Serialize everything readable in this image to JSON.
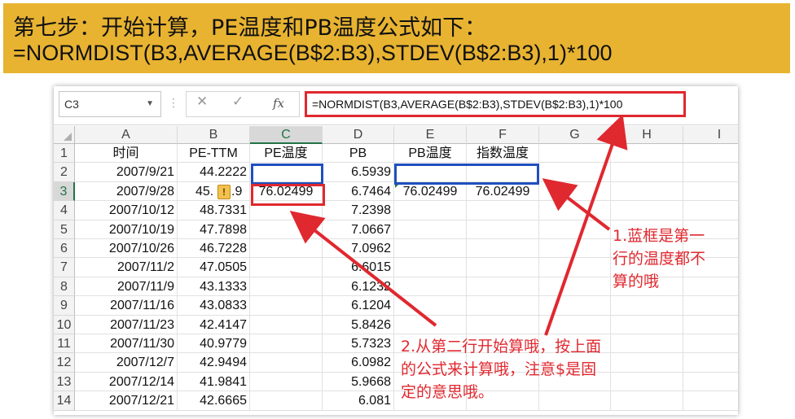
{
  "header": {
    "title": "第七步：开始计算，PE温度和PB温度公式如下：",
    "formula": "=NORMDIST(B3,AVERAGE(B$2:B3),STDEV(B$2:B3),1)*100"
  },
  "excel": {
    "name_box": "C3",
    "formula_bar_value": "=NORMDIST(B3,AVERAGE(B$2:B3),STDEV(B$2:B3),1)*100",
    "fx_label": "fx",
    "columns": [
      "A",
      "B",
      "C",
      "D",
      "E",
      "F",
      "G",
      "H",
      "I"
    ],
    "row_numbers": [
      "1",
      "2",
      "3",
      "4",
      "5",
      "6",
      "7",
      "8",
      "9",
      "10",
      "11",
      "12",
      "13",
      "14"
    ],
    "headers": {
      "A": "时间",
      "B": "PE-TTM",
      "C": "PE温度",
      "D": "PB",
      "E": "PB温度",
      "F": "指数温度"
    },
    "rows": [
      {
        "A": "2007/9/21",
        "B": "44.2222",
        "C": "",
        "D": "6.5939",
        "E": "",
        "F": ""
      },
      {
        "A": "2007/9/28",
        "B": "45.",
        "B_tail": ".9",
        "C": "76.02499",
        "D": "6.7464",
        "E": "76.02499",
        "F": "76.02499"
      },
      {
        "A": "2007/10/12",
        "B": "48.7331",
        "D": "7.2398"
      },
      {
        "A": "2007/10/19",
        "B": "47.7898",
        "D": "7.0667"
      },
      {
        "A": "2007/10/26",
        "B": "46.7228",
        "D": "7.0962"
      },
      {
        "A": "2007/11/2",
        "B": "47.0505",
        "D": "6.6015"
      },
      {
        "A": "2007/11/9",
        "B": "43.1333",
        "D": "6.1232"
      },
      {
        "A": "2007/11/16",
        "B": "43.0833",
        "D": "6.1204"
      },
      {
        "A": "2007/11/23",
        "B": "42.4147",
        "D": "5.8426"
      },
      {
        "A": "2007/11/30",
        "B": "40.9779",
        "D": "5.7323"
      },
      {
        "A": "2007/12/7",
        "B": "42.9494",
        "D": "6.0982"
      },
      {
        "A": "2007/12/14",
        "B": "41.9841",
        "D": "5.9668"
      },
      {
        "A": "2007/12/21",
        "B": "42.6665",
        "D": "6.081"
      }
    ]
  },
  "annotations": {
    "note1": [
      "1.蓝框是第一",
      "行的温度都不",
      "算的哦"
    ],
    "note2": [
      "2.从第二行开始算哦，按上面",
      "的公式来计算哦，注意$是固",
      "定的意思哦。"
    ]
  },
  "colors": {
    "banner": "#e8b331",
    "red": "#e0282f",
    "blue": "#1f4fbf",
    "excel_green": "#217346"
  }
}
